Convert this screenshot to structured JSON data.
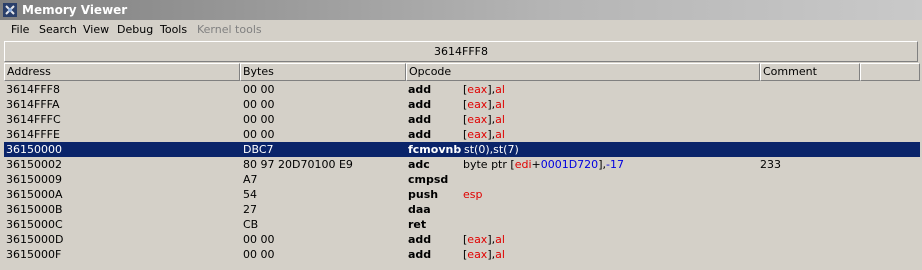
{
  "window": {
    "title": "Memory Viewer"
  },
  "menu": [
    "File",
    "Search",
    "View",
    "Debug",
    "Tools",
    "Kernel tools"
  ],
  "address_bar": {
    "value": "3614FFF8"
  },
  "columns": [
    "Address",
    "Bytes",
    "Opcode",
    "Comment"
  ],
  "rows": [
    {
      "address": "3614FFF8",
      "bytes": "00 00",
      "op": "add",
      "args": [
        {
          "t": "[",
          "c": ""
        },
        {
          "t": "eax",
          "c": "reg"
        },
        {
          "t": "],",
          "c": ""
        },
        {
          "t": "al",
          "c": "reg"
        }
      ],
      "comment": "",
      "selected": false
    },
    {
      "address": "3614FFFA",
      "bytes": "00 00",
      "op": "add",
      "args": [
        {
          "t": "[",
          "c": ""
        },
        {
          "t": "eax",
          "c": "reg"
        },
        {
          "t": "],",
          "c": ""
        },
        {
          "t": "al",
          "c": "reg"
        }
      ],
      "comment": "",
      "selected": false
    },
    {
      "address": "3614FFFC",
      "bytes": "00 00",
      "op": "add",
      "args": [
        {
          "t": "[",
          "c": ""
        },
        {
          "t": "eax",
          "c": "reg"
        },
        {
          "t": "],",
          "c": ""
        },
        {
          "t": "al",
          "c": "reg"
        }
      ],
      "comment": "",
      "selected": false
    },
    {
      "address": "3614FFFE",
      "bytes": "00 00",
      "op": "add",
      "args": [
        {
          "t": "[",
          "c": ""
        },
        {
          "t": "eax",
          "c": "reg"
        },
        {
          "t": "],",
          "c": ""
        },
        {
          "t": "al",
          "c": "reg"
        }
      ],
      "comment": "",
      "selected": false
    },
    {
      "address": "36150000",
      "bytes": "DBC7",
      "op": "fcmovnb",
      "args": [
        {
          "t": "st(0),st(7)",
          "c": ""
        }
      ],
      "comment": "",
      "selected": true
    },
    {
      "address": "36150002",
      "bytes": "80 97 20D70100 E9",
      "op": "adc",
      "args": [
        {
          "t": "byte ptr [",
          "c": ""
        },
        {
          "t": "edi",
          "c": "reg"
        },
        {
          "t": "+",
          "c": ""
        },
        {
          "t": "0001D720",
          "c": "num"
        },
        {
          "t": "],",
          "c": ""
        },
        {
          "t": "-17",
          "c": "num"
        }
      ],
      "comment": "233",
      "selected": false
    },
    {
      "address": "36150009",
      "bytes": "A7",
      "op": "cmpsd",
      "args": [],
      "comment": "",
      "selected": false
    },
    {
      "address": "3615000A",
      "bytes": "54",
      "op": "push",
      "args": [
        {
          "t": "esp",
          "c": "reg"
        }
      ],
      "comment": "",
      "selected": false
    },
    {
      "address": "3615000B",
      "bytes": "27",
      "op": "daa",
      "args": [],
      "comment": "",
      "selected": false
    },
    {
      "address": "3615000C",
      "bytes": "CB",
      "op": "ret",
      "args": [],
      "comment": "",
      "selected": false
    },
    {
      "address": "3615000D",
      "bytes": "00 00",
      "op": "add",
      "args": [
        {
          "t": "[",
          "c": ""
        },
        {
          "t": "eax",
          "c": "reg"
        },
        {
          "t": "],",
          "c": ""
        },
        {
          "t": "al",
          "c": "reg"
        }
      ],
      "comment": "",
      "selected": false
    },
    {
      "address": "3615000F",
      "bytes": "00 00",
      "op": "add",
      "args": [
        {
          "t": "[",
          "c": ""
        },
        {
          "t": "eax",
          "c": "reg"
        },
        {
          "t": "],",
          "c": ""
        },
        {
          "t": "al",
          "c": "reg"
        }
      ],
      "comment": "",
      "selected": false
    }
  ]
}
